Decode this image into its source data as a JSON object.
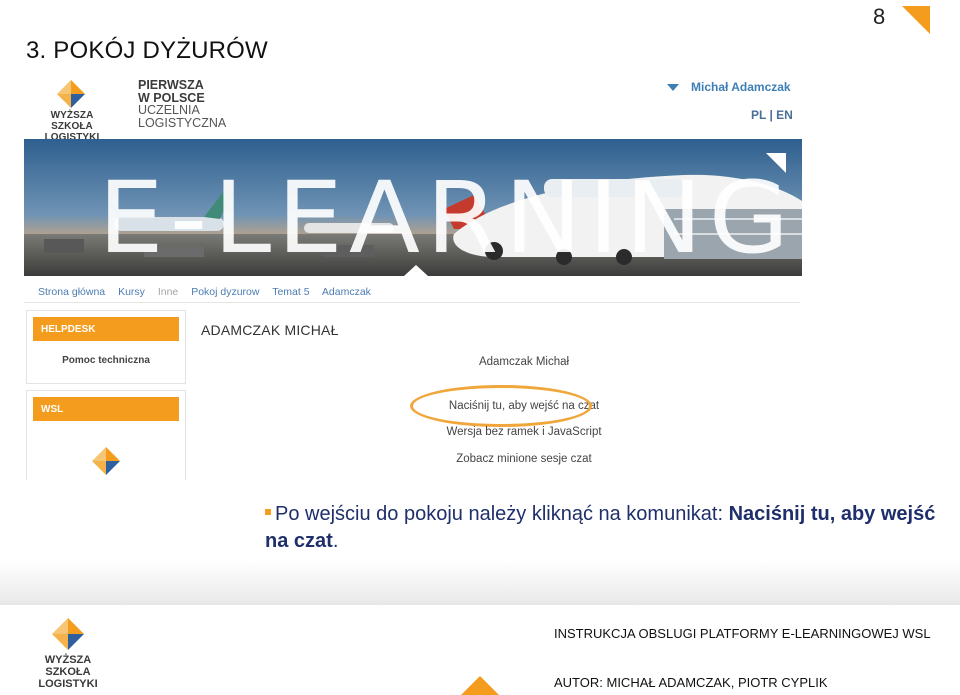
{
  "slide": {
    "title": "3. POKÓJ DYŻURÓW",
    "page_number": "8"
  },
  "colors": {
    "accent_orange": "#f39c1d",
    "link_blue": "#4b7db2",
    "caption_navy": "#1f2f6b",
    "oval_orange": "#f0a63a"
  },
  "site": {
    "logo_lines": [
      "WYŻSZA SZKOŁA",
      "LOGISTYKI"
    ],
    "slogan_lines": [
      "PIERWSZA",
      "W POLSCE",
      "UCZELNIA",
      "LOGISTYCZNA"
    ],
    "user_name": "Michał Adamczak",
    "user_icon": "chevron-down-icon",
    "lang": "PL | EN",
    "banner_title": "E-LEARNING"
  },
  "nav": {
    "items": [
      {
        "label": "Strona główna"
      },
      {
        "label": "Kursy"
      },
      {
        "label": "Inne"
      },
      {
        "label": "Pokoj dyzurow"
      },
      {
        "label": "Temat 5"
      },
      {
        "label": "Adamczak"
      }
    ]
  },
  "blocks": {
    "helpdesk": {
      "title": "HELPDESK",
      "item": "Pomoc techniczna"
    },
    "wsl": {
      "title": "WSL"
    }
  },
  "main": {
    "profile_name": "ADAMCZAK MICHAŁ",
    "chat_user": "Adamczak Michał",
    "enter_chat": "Naciśnij tu, aby wejść na czat",
    "no_frames": "Wersja bez ramek i JavaScript",
    "past_sessions": "Zobacz minione sesje czat"
  },
  "caption": {
    "text": "Po wejściu do pokoju należy kliknąć na komunikat: ",
    "highlight": "Naciśnij tu, aby wejść na czat",
    "end": "."
  },
  "footer": {
    "logo_lines": [
      "WYŻSZA SZKOŁA",
      "LOGISTYKI"
    ],
    "instructions": "INSTRUKCJA OBSLUGI PLATFORMY E-LEARNINGOWEJ WSL",
    "authors": "AUTOR: MICHAŁ ADAMCZAK, PIOTR CYPLIK"
  }
}
